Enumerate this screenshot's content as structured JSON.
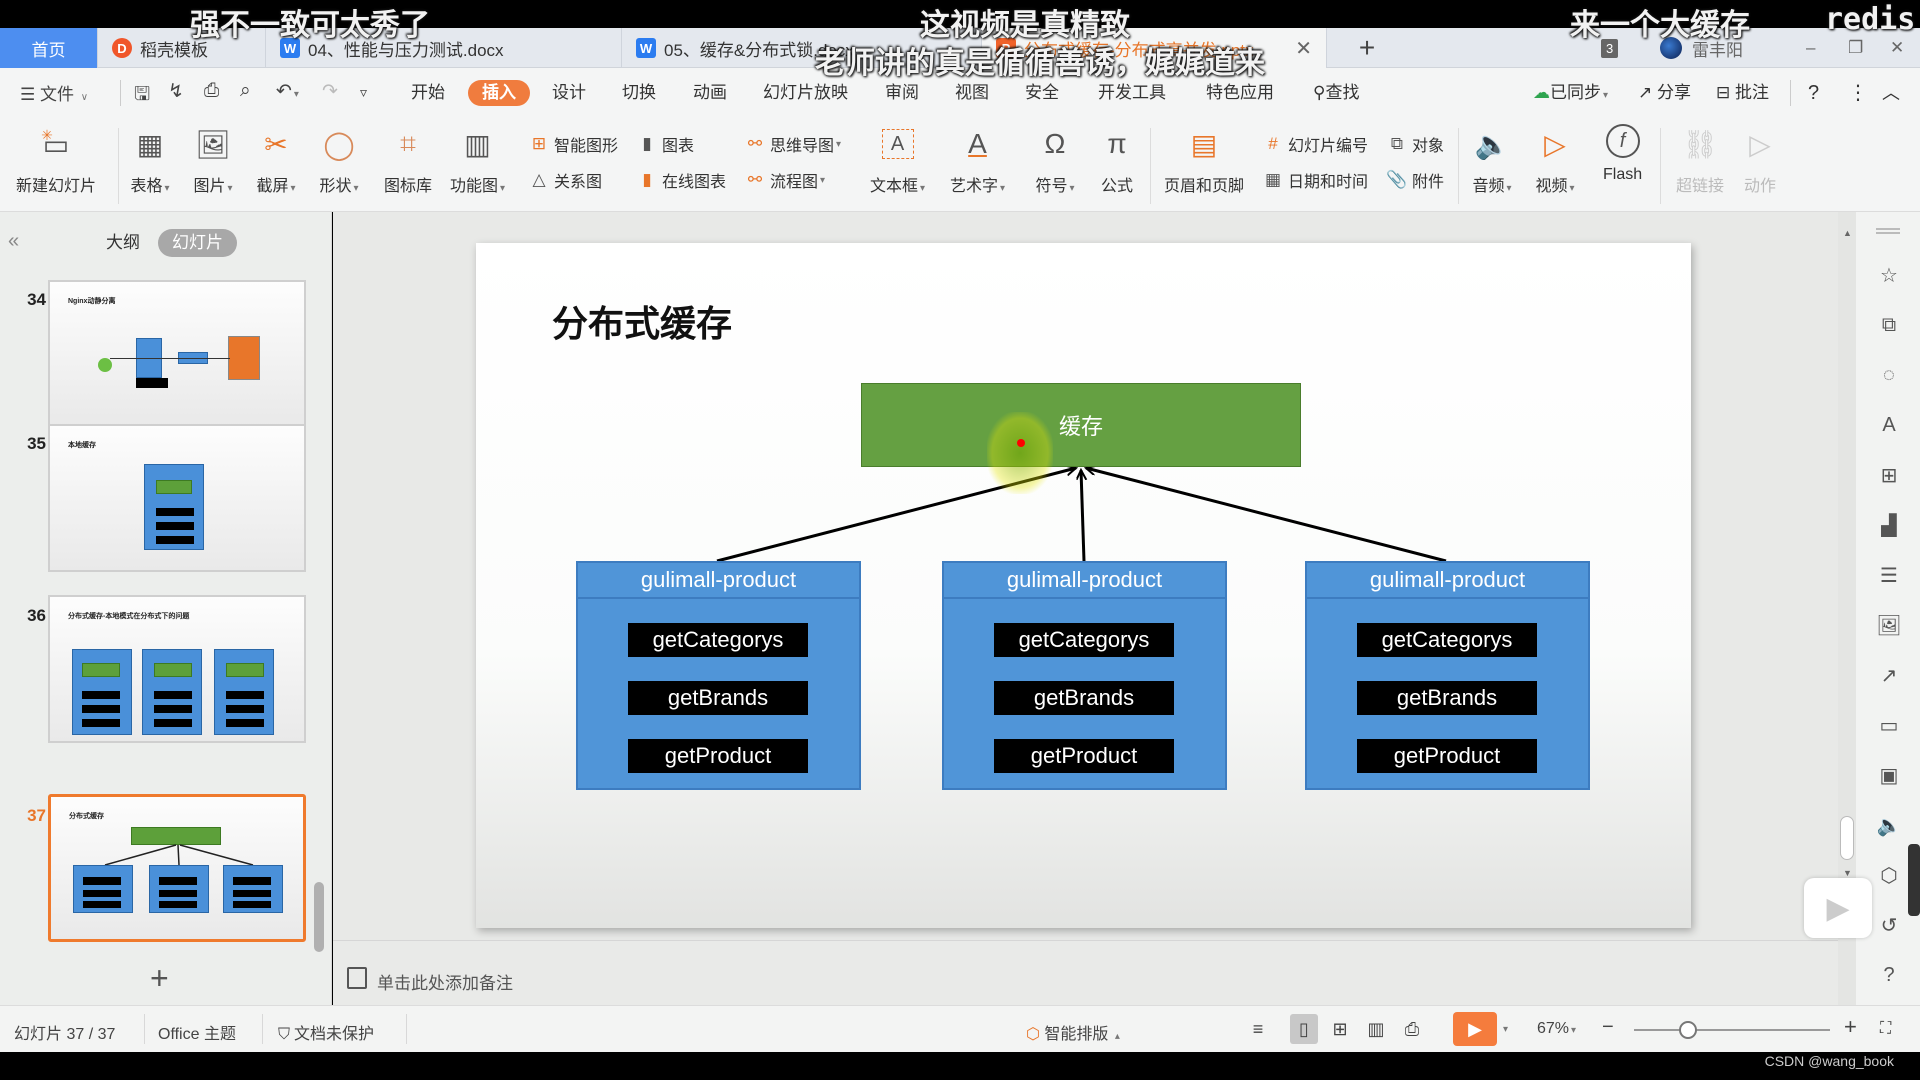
{
  "overlay": {
    "danmaku": [
      "强不一致可太秀了",
      "这视频是真精致",
      "老师讲的真是循循善诱，娓娓道来",
      "来一个大缓存",
      "redis"
    ]
  },
  "tabs": [
    {
      "label": "首页",
      "kind": "home"
    },
    {
      "label": "稻壳模板",
      "kind": "docer",
      "icon": "docer-icon"
    },
    {
      "label": "04、性能与压力测试.docx",
      "kind": "word",
      "icon": "word-icon"
    },
    {
      "label": "05、缓存&分布式锁.docx",
      "kind": "word",
      "icon": "word-icon"
    },
    {
      "label": "分布式缓存-分布式高并发.pptx",
      "kind": "ppt",
      "icon": "ppt-icon",
      "active": true
    }
  ],
  "titlebar": {
    "new_tab": "+",
    "window_count": "3",
    "user_name": "雷丰阳",
    "minimize": "–",
    "restore": "❐",
    "close": "✕"
  },
  "menu": {
    "file": "文件",
    "items": [
      "开始",
      "插入",
      "设计",
      "切换",
      "动画",
      "幻灯片放映",
      "审阅",
      "视图",
      "安全",
      "开发工具",
      "特色应用"
    ],
    "active": "插入",
    "search": "查找",
    "sync": "已同步",
    "share": "分享",
    "comment": "批注"
  },
  "ribbon": {
    "new_slide": "新建幻灯片",
    "table": "表格",
    "picture": "图片",
    "screenshot": "截屏",
    "shape": "形状",
    "icon_lib": "图标库",
    "function_chart": "功能图",
    "smart_art": "智能图形",
    "chart": "图表",
    "mind_map": "思维导图",
    "relation": "关系图",
    "online_chart": "在线图表",
    "flowchart": "流程图",
    "textbox": "文本框",
    "wordart": "艺术字",
    "symbol": "符号",
    "formula": "公式",
    "header_footer": "页眉和页脚",
    "slide_number": "幻灯片编号",
    "object": "对象",
    "datetime": "日期和时间",
    "attachment": "附件",
    "audio": "音频",
    "video": "视频",
    "flash": "Flash",
    "hyperlink": "超链接",
    "action": "动作"
  },
  "leftpanel": {
    "tabs": [
      "大纲",
      "幻灯片"
    ],
    "active_tab": "幻灯片",
    "thumbnails": [
      {
        "number": "34",
        "title": "Nginx动静分离"
      },
      {
        "number": "35",
        "title": "本地缓存"
      },
      {
        "number": "36",
        "title": "分布式缓存-本地模式在分布式下的问题"
      },
      {
        "number": "37",
        "title": "分布式缓存",
        "active": true
      }
    ],
    "add_slide": "+"
  },
  "slide": {
    "title": "分布式缓存",
    "cache_label": "缓存",
    "services": [
      {
        "name": "gulimall-product",
        "methods": [
          "getCategorys",
          "getBrands",
          "getProduct"
        ]
      },
      {
        "name": "gulimall-product",
        "methods": [
          "getCategorys",
          "getBrands",
          "getProduct"
        ]
      },
      {
        "name": "gulimall-product",
        "methods": [
          "getCategorys",
          "getBrands",
          "getProduct"
        ]
      }
    ],
    "colors": {
      "cache": "#65a042",
      "service": "#5095d8",
      "method": "#000000"
    }
  },
  "notes": {
    "placeholder": "单击此处添加备注"
  },
  "statusbar": {
    "slide_info": "幻灯片 37 / 37",
    "theme": "Office 主题",
    "protection": "文档未保护",
    "smart_layout": "智能排版",
    "zoom": "67%",
    "zoom_minus": "−",
    "zoom_plus": "+",
    "zoom_fraction": 0.5
  },
  "watermark": "CSDN @wang_book",
  "accent": "#f07c3e"
}
